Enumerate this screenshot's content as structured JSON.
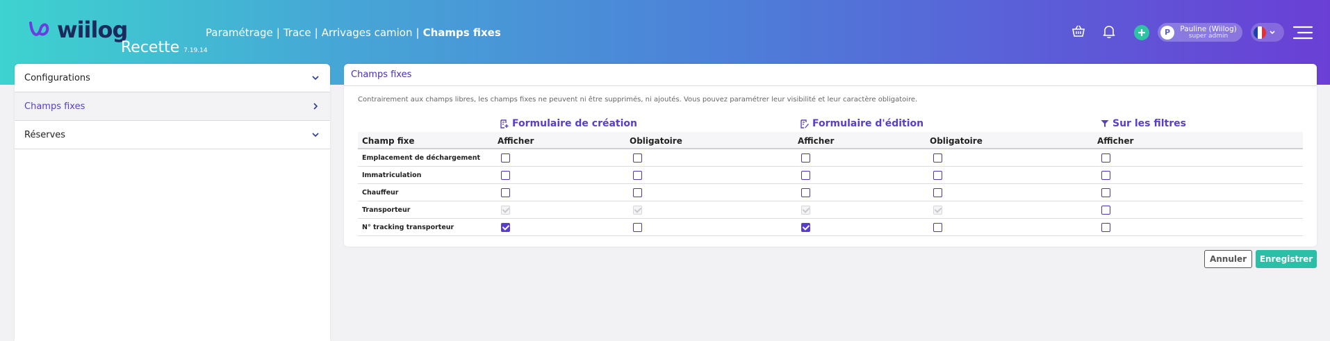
{
  "header": {
    "logo_text": "wiilog",
    "environment": "Recette",
    "version": "7.19.14",
    "breadcrumb": [
      "Paramétrage",
      "Trace",
      "Arrivages camion"
    ],
    "breadcrumb_separator": "|",
    "current_page": "Champs fixes",
    "user": {
      "initial": "P",
      "name": "Pauline (Wiilog)",
      "role": "super admin"
    },
    "icons": [
      "basket-icon",
      "bell-icon",
      "plus-circle-icon",
      "french-flag-icon",
      "chevron-down-icon",
      "hamburger-menu-icon"
    ],
    "colors": {
      "gradient_start": "#3dd3cf",
      "gradient_end": "#6a3fd5",
      "accent": "#5a3ec8",
      "save": "#2bbfa8"
    }
  },
  "sidebar": {
    "items": [
      {
        "label": "Configurations",
        "icon": "chevron-down-icon",
        "active": false
      },
      {
        "label": "Champs fixes",
        "icon": "chevron-right-icon",
        "active": true
      },
      {
        "label": "Réserves",
        "icon": "chevron-down-icon",
        "active": false
      }
    ]
  },
  "panel": {
    "title": "Champs fixes",
    "description": "Contrairement aux champs libres, les champs fixes ne peuvent ni être supprimés, ni ajoutés. Vous pouvez paramétrer leur visibilité et leur caractère obligatoire.",
    "groups": [
      {
        "label": "Formulaire de création",
        "icon": "form-create-icon"
      },
      {
        "label": "Formulaire d'édition",
        "icon": "form-edit-icon"
      },
      {
        "label": "Sur les filtres",
        "icon": "filter-icon"
      }
    ],
    "columns": [
      "Champ fixe",
      "Afficher",
      "Obligatoire",
      "Afficher",
      "Obligatoire",
      "Afficher"
    ],
    "rows": [
      {
        "label": "Emplacement de déchargement",
        "values": [
          "unchecked",
          "unchecked",
          "unchecked",
          "unchecked",
          "unchecked"
        ]
      },
      {
        "label": "Immatriculation",
        "values": [
          "unchecked",
          "unchecked",
          "unchecked",
          "unchecked",
          "unchecked"
        ]
      },
      {
        "label": "Chauffeur",
        "values": [
          "unchecked",
          "unchecked",
          "unchecked",
          "unchecked",
          "unchecked"
        ]
      },
      {
        "label": "Transporteur",
        "values": [
          "disabled",
          "disabled",
          "disabled",
          "disabled",
          "unchecked"
        ]
      },
      {
        "label": "N° tracking transporteur",
        "values": [
          "checked",
          "unchecked",
          "checked",
          "unchecked",
          "unchecked"
        ]
      }
    ]
  },
  "actions": {
    "cancel_label": "Annuler",
    "save_label": "Enregistrer"
  }
}
